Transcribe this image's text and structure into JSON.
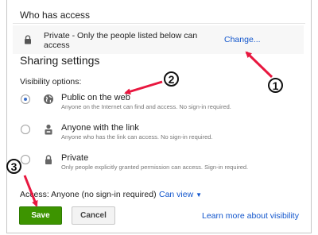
{
  "who_has_access": {
    "title": "Who has access",
    "access_text": "Private - Only the people listed below can access",
    "change_link": "Change..."
  },
  "sharing": {
    "title": "Sharing settings",
    "visibility_label": "Visibility options:",
    "options": [
      {
        "title": "Public on the web",
        "desc": "Anyone on the Internet can find and access. No sign-in required.",
        "icon": "globe-icon",
        "selected": true
      },
      {
        "title": "Anyone with the link",
        "desc": "Anyone who has the link can access. No sign-in required.",
        "icon": "person-link-icon",
        "selected": false
      },
      {
        "title": "Private",
        "desc": "Only people explicitly granted permission can access. Sign-in required.",
        "icon": "lock-icon",
        "selected": false
      }
    ]
  },
  "footer": {
    "access_label": "Access:",
    "access_value": "Anyone (no sign-in required)",
    "can_view": "Can view",
    "save": "Save",
    "cancel": "Cancel",
    "learn_more": "Learn more about visibility"
  },
  "callouts": [
    "1",
    "2",
    "3"
  ],
  "colors": {
    "accent": "#1155cc",
    "save_green": "#3d9400",
    "arrow_red": "#e8173f"
  }
}
